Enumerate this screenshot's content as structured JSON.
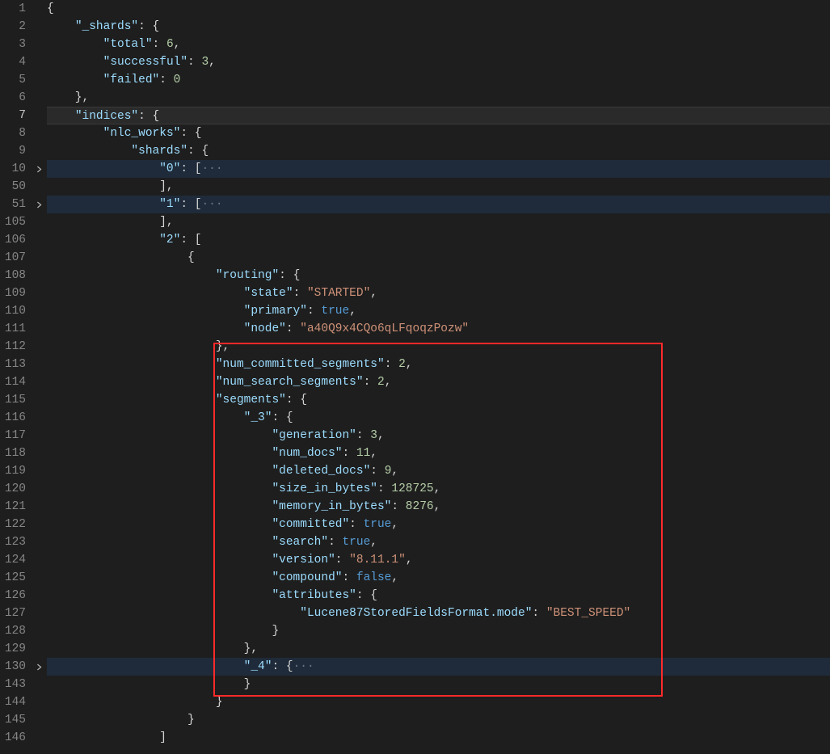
{
  "gutter": {
    "nums": [
      "1",
      "2",
      "3",
      "4",
      "5",
      "6",
      "7",
      "8",
      "9",
      "10",
      "50",
      "51",
      "105",
      "106",
      "107",
      "108",
      "109",
      "110",
      "111",
      "112",
      "113",
      "114",
      "115",
      "116",
      "117",
      "118",
      "119",
      "120",
      "121",
      "122",
      "123",
      "124",
      "125",
      "126",
      "127",
      "128",
      "129",
      "130",
      "143",
      "144",
      "145",
      "146"
    ]
  },
  "fold_positions": [
    9,
    11,
    37
  ],
  "highlight_rows": [
    9,
    11,
    37
  ],
  "cursor_row": 6,
  "lines": [
    [
      [
        "p",
        "{"
      ]
    ],
    [
      [
        "p",
        "    "
      ],
      [
        "k",
        "\"_shards\""
      ],
      [
        "p",
        ": {"
      ]
    ],
    [
      [
        "p",
        "        "
      ],
      [
        "k",
        "\"total\""
      ],
      [
        "p",
        ": "
      ],
      [
        "n",
        "6"
      ],
      [
        "p",
        ","
      ]
    ],
    [
      [
        "p",
        "        "
      ],
      [
        "k",
        "\"successful\""
      ],
      [
        "p",
        ": "
      ],
      [
        "n",
        "3"
      ],
      [
        "p",
        ","
      ]
    ],
    [
      [
        "p",
        "        "
      ],
      [
        "k",
        "\"failed\""
      ],
      [
        "p",
        ": "
      ],
      [
        "n",
        "0"
      ]
    ],
    [
      [
        "p",
        "    },"
      ]
    ],
    [
      [
        "p",
        "    "
      ],
      [
        "k",
        "\"indices\""
      ],
      [
        "p",
        ": {"
      ]
    ],
    [
      [
        "p",
        "        "
      ],
      [
        "k",
        "\"nlc_works\""
      ],
      [
        "p",
        ": {"
      ]
    ],
    [
      [
        "p",
        "            "
      ],
      [
        "k",
        "\"shards\""
      ],
      [
        "p",
        ": {"
      ]
    ],
    [
      [
        "p",
        "                "
      ],
      [
        "k",
        "\"0\""
      ],
      [
        "p",
        ": ["
      ],
      [
        "el",
        "···"
      ]
    ],
    [
      [
        "p",
        "                ],"
      ]
    ],
    [
      [
        "p",
        "                "
      ],
      [
        "k",
        "\"1\""
      ],
      [
        "p",
        ": ["
      ],
      [
        "el",
        "···"
      ]
    ],
    [
      [
        "p",
        "                ],"
      ]
    ],
    [
      [
        "p",
        "                "
      ],
      [
        "k",
        "\"2\""
      ],
      [
        "p",
        ": ["
      ]
    ],
    [
      [
        "p",
        "                    {"
      ]
    ],
    [
      [
        "p",
        "                        "
      ],
      [
        "k",
        "\"routing\""
      ],
      [
        "p",
        ": {"
      ]
    ],
    [
      [
        "p",
        "                            "
      ],
      [
        "k",
        "\"state\""
      ],
      [
        "p",
        ": "
      ],
      [
        "s",
        "\"STARTED\""
      ],
      [
        "p",
        ","
      ]
    ],
    [
      [
        "p",
        "                            "
      ],
      [
        "k",
        "\"primary\""
      ],
      [
        "p",
        ": "
      ],
      [
        "b",
        "true"
      ],
      [
        "p",
        ","
      ]
    ],
    [
      [
        "p",
        "                            "
      ],
      [
        "k",
        "\"node\""
      ],
      [
        "p",
        ": "
      ],
      [
        "s",
        "\"a40Q9x4CQo6qLFqoqzPozw\""
      ]
    ],
    [
      [
        "p",
        "                        },"
      ]
    ],
    [
      [
        "p",
        "                        "
      ],
      [
        "k",
        "\"num_committed_segments\""
      ],
      [
        "p",
        ": "
      ],
      [
        "n",
        "2"
      ],
      [
        "p",
        ","
      ]
    ],
    [
      [
        "p",
        "                        "
      ],
      [
        "k",
        "\"num_search_segments\""
      ],
      [
        "p",
        ": "
      ],
      [
        "n",
        "2"
      ],
      [
        "p",
        ","
      ]
    ],
    [
      [
        "p",
        "                        "
      ],
      [
        "k",
        "\"segments\""
      ],
      [
        "p",
        ": {"
      ]
    ],
    [
      [
        "p",
        "                            "
      ],
      [
        "k",
        "\"_3\""
      ],
      [
        "p",
        ": {"
      ]
    ],
    [
      [
        "p",
        "                                "
      ],
      [
        "k",
        "\"generation\""
      ],
      [
        "p",
        ": "
      ],
      [
        "n",
        "3"
      ],
      [
        "p",
        ","
      ]
    ],
    [
      [
        "p",
        "                                "
      ],
      [
        "k",
        "\"num_docs\""
      ],
      [
        "p",
        ": "
      ],
      [
        "n",
        "11"
      ],
      [
        "p",
        ","
      ]
    ],
    [
      [
        "p",
        "                                "
      ],
      [
        "k",
        "\"deleted_docs\""
      ],
      [
        "p",
        ": "
      ],
      [
        "n",
        "9"
      ],
      [
        "p",
        ","
      ]
    ],
    [
      [
        "p",
        "                                "
      ],
      [
        "k",
        "\"size_in_bytes\""
      ],
      [
        "p",
        ": "
      ],
      [
        "n",
        "128725"
      ],
      [
        "p",
        ","
      ]
    ],
    [
      [
        "p",
        "                                "
      ],
      [
        "k",
        "\"memory_in_bytes\""
      ],
      [
        "p",
        ": "
      ],
      [
        "n",
        "8276"
      ],
      [
        "p",
        ","
      ]
    ],
    [
      [
        "p",
        "                                "
      ],
      [
        "k",
        "\"committed\""
      ],
      [
        "p",
        ": "
      ],
      [
        "b",
        "true"
      ],
      [
        "p",
        ","
      ]
    ],
    [
      [
        "p",
        "                                "
      ],
      [
        "k",
        "\"search\""
      ],
      [
        "p",
        ": "
      ],
      [
        "b",
        "true"
      ],
      [
        "p",
        ","
      ]
    ],
    [
      [
        "p",
        "                                "
      ],
      [
        "k",
        "\"version\""
      ],
      [
        "p",
        ": "
      ],
      [
        "s",
        "\"8.11.1\""
      ],
      [
        "p",
        ","
      ]
    ],
    [
      [
        "p",
        "                                "
      ],
      [
        "k",
        "\"compound\""
      ],
      [
        "p",
        ": "
      ],
      [
        "b",
        "false"
      ],
      [
        "p",
        ","
      ]
    ],
    [
      [
        "p",
        "                                "
      ],
      [
        "k",
        "\"attributes\""
      ],
      [
        "p",
        ": {"
      ]
    ],
    [
      [
        "p",
        "                                    "
      ],
      [
        "k",
        "\"Lucene87StoredFieldsFormat.mode\""
      ],
      [
        "p",
        ": "
      ],
      [
        "s",
        "\"BEST_SPEED\""
      ]
    ],
    [
      [
        "p",
        "                                }"
      ]
    ],
    [
      [
        "p",
        "                            },"
      ]
    ],
    [
      [
        "p",
        "                            "
      ],
      [
        "k",
        "\"_4\""
      ],
      [
        "p",
        ": {"
      ],
      [
        "el",
        "···"
      ]
    ],
    [
      [
        "p",
        "                            }"
      ]
    ],
    [
      [
        "p",
        "                        }"
      ]
    ],
    [
      [
        "p",
        "                    }"
      ]
    ],
    [
      [
        "p",
        "                ]"
      ]
    ]
  ]
}
